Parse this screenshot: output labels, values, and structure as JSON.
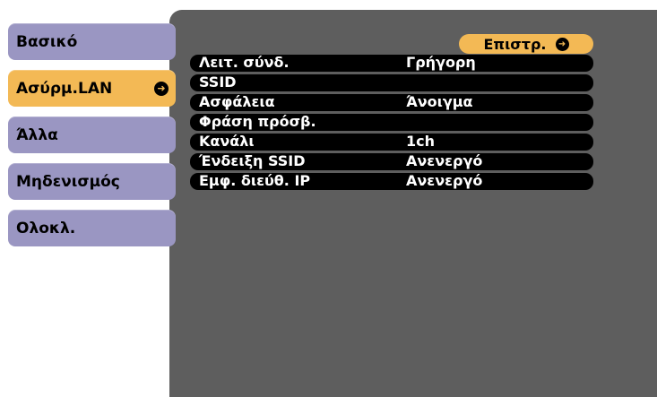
{
  "sidebar": {
    "items": [
      {
        "label": "Βασικό",
        "active": false
      },
      {
        "label": "Ασύρμ.LAN",
        "active": true
      },
      {
        "label": "Άλλα",
        "active": false
      },
      {
        "label": "Μηδενισμός",
        "active": false
      },
      {
        "label": "Ολοκλ.",
        "active": false
      }
    ]
  },
  "back_button": {
    "label": "Επιστρ."
  },
  "settings": [
    {
      "label": "Λειτ. σύνδ.",
      "value": "Γρήγορη"
    },
    {
      "label": "SSID",
      "value": ""
    },
    {
      "label": "Ασφάλεια",
      "value": "Άνοιγμα"
    },
    {
      "label": "Φράση πρόσβ.",
      "value": ""
    },
    {
      "label": "Κανάλι",
      "value": "1ch"
    },
    {
      "label": "Ένδειξη SSID",
      "value": "Ανενεργό"
    },
    {
      "label": "Εμφ. διεύθ. IP",
      "value": "Ανενεργό"
    }
  ],
  "colors": {
    "tab_inactive": "#9a96c2",
    "tab_active": "#f3b955",
    "panel": "#5e5e5e",
    "row": "#000000"
  }
}
